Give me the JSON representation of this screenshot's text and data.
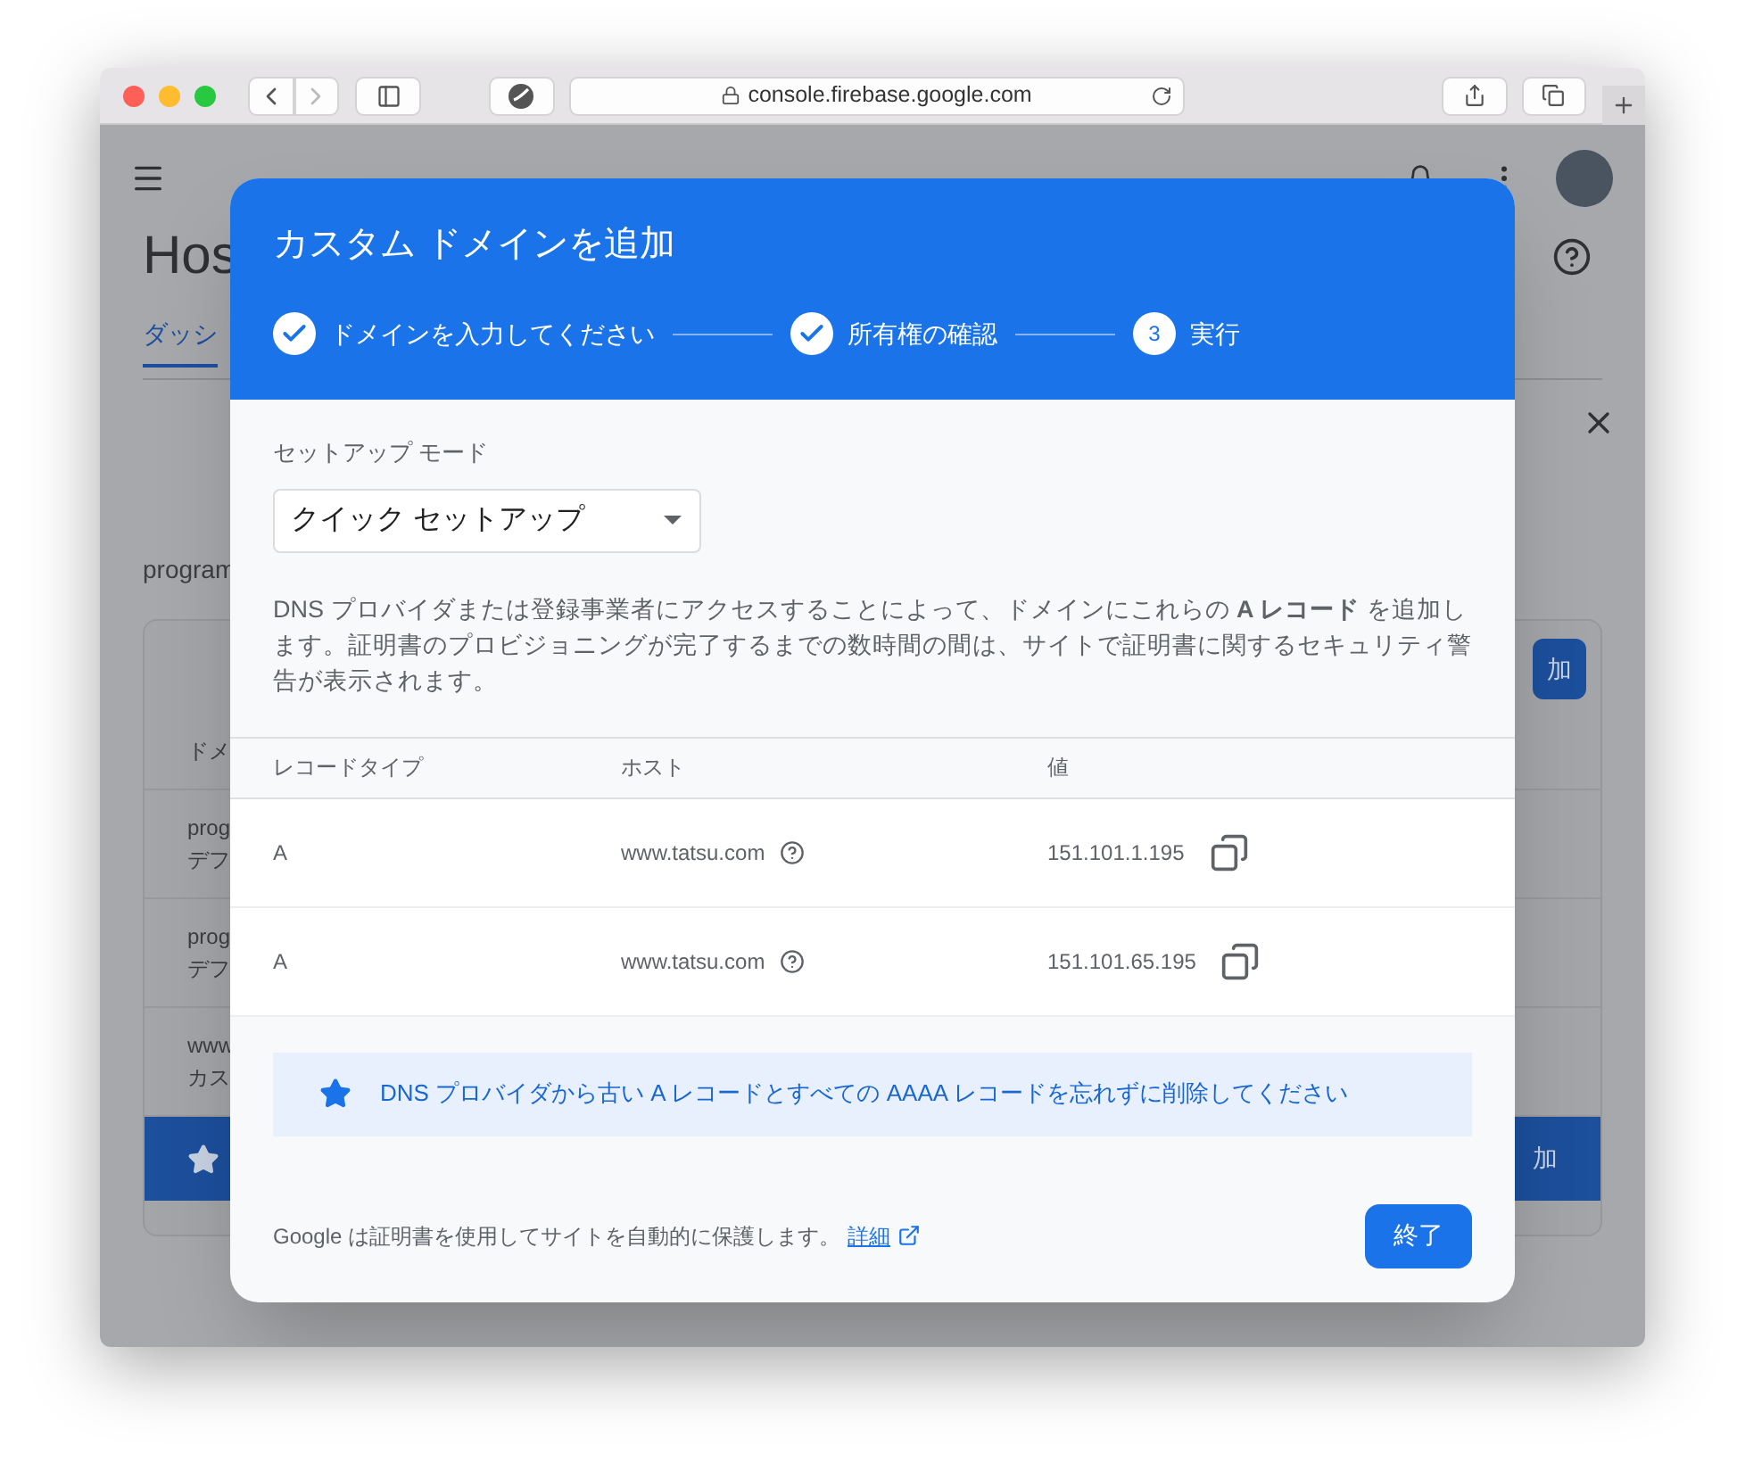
{
  "browser": {
    "url": "console.firebase.google.com"
  },
  "page": {
    "title": "Hos",
    "tab": "ダッシ",
    "section": "program",
    "add_button": "加",
    "column_1": "ドメ",
    "rows": [
      {
        "line_1": "prog",
        "line_2": "デフ"
      },
      {
        "line_1": "prog",
        "line_2": "デフ"
      },
      {
        "line_1": "www",
        "line_2": "カス"
      }
    ],
    "banner_button": "加"
  },
  "dialog": {
    "title": "カスタム ドメインを追加",
    "steps": [
      {
        "label": "ドメインを入力してください",
        "completed": true
      },
      {
        "label": "所有権の確認",
        "completed": true
      },
      {
        "label": "実行",
        "completed": false,
        "number": "3"
      }
    ],
    "mode_label": "セットアップ モード",
    "mode_value": "クイック セットアップ",
    "description": "DNS プロバイダまたは登録事業者にアクセスすることによって、ドメインにこれらの **A レコード** を追加します。証明書のプロビジョニングが完了するまでの数時間の間は、サイトで証明書に関するセキュリティ警告が表示されます。",
    "columns": [
      "レコードタイプ",
      "ホスト",
      "値"
    ],
    "records": [
      {
        "type": "A",
        "host": "www.tatsu.com",
        "value": "151.101.1.195"
      },
      {
        "type": "A",
        "host": "www.tatsu.com",
        "value": "151.101.65.195"
      }
    ],
    "notice": "DNS プロバイダから古い A レコードとすべての AAAA レコードを忘れずに削除してください",
    "footer_text": "Google は証明書を使用してサイトを自動的に保護します。",
    "footer_link": "詳細",
    "done_button": "終了"
  }
}
